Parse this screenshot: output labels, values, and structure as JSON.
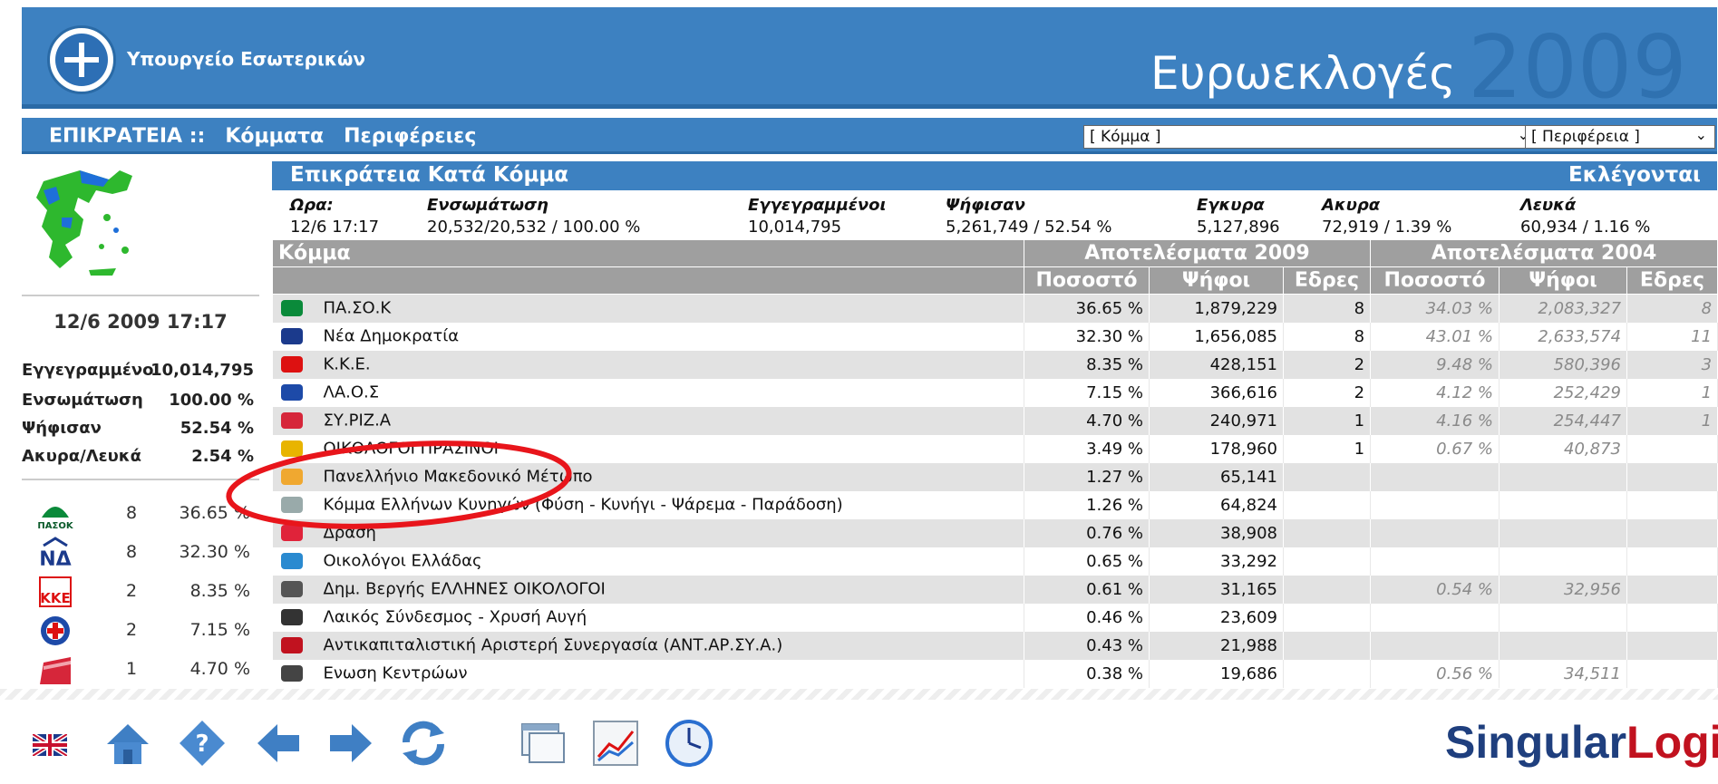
{
  "header": {
    "ministry": "Υπουργείο Εσωτερικών",
    "title": "Ευρωεκλογές",
    "year": "2009"
  },
  "nav": {
    "scope": "ΕΠΙΚΡΑΤΕΙΑ ::",
    "link_parties": "Κόμματα",
    "link_regions": "Περιφέρειες",
    "party_select": "[ Κόμμα ]",
    "region_select": "[ Περιφέρεια ]"
  },
  "left": {
    "datetime": "12/6 2009 17:17",
    "stats": [
      {
        "label": "Εγγεγραμμένοι",
        "value": "10,014,795"
      },
      {
        "label": "Ενσωμάτωση",
        "value": "100.00 %"
      },
      {
        "label": "Ψήφισαν",
        "value": "52.54 %"
      },
      {
        "label": "Ακυρα/Λευκά",
        "value": "2.54 %"
      }
    ],
    "parties": [
      {
        "logo": "ΠΑΣΟΚ",
        "seats": "8",
        "pct": "36.65 %"
      },
      {
        "logo": "ΝΔ",
        "seats": "8",
        "pct": "32.30 %"
      },
      {
        "logo": "ΚΚΕ",
        "seats": "2",
        "pct": "8.35 %"
      },
      {
        "logo": "ΛΑΟΣ",
        "seats": "2",
        "pct": "7.15 %"
      },
      {
        "logo": "ΣΥΡΙΖΑ",
        "seats": "1",
        "pct": "4.70 %"
      }
    ]
  },
  "main": {
    "title": "Επικράτεια Κατά Κόμμα",
    "right_title": "Εκλέγονται",
    "summary": {
      "labels": [
        "Ωρα:",
        "Ενσωμάτωση",
        "Εγγεγραμμένοι",
        "Ψήφισαν",
        "Εγκυρα",
        "Ακυρα",
        "Λευκά"
      ],
      "values": [
        "12/6 17:17",
        "20,532/20,532 / 100.00 %",
        "10,014,795",
        "5,261,749 / 52.54 %",
        "5,127,896",
        "72,919 / 1.39 %",
        "60,934 / 1.16 %"
      ]
    },
    "col_party": "Κόμμα",
    "group_2009": "Αποτελέσματα 2009",
    "group_2004": "Αποτελέσματα 2004",
    "sub": {
      "pct": "Ποσοστό",
      "votes": "Ψήφοι",
      "seats": "Εδρες"
    },
    "rows": [
      {
        "logo": "ΠΑΣΟΚ",
        "name": "ΠΑ.ΣΟ.Κ",
        "pct": "36.65 %",
        "votes": "1,879,229",
        "seats": "8",
        "pct04": "34.03 %",
        "votes04": "2,083,327",
        "seats04": "8"
      },
      {
        "logo": "ΝΔ",
        "name": "Νέα Δημοκρατία",
        "pct": "32.30 %",
        "votes": "1,656,085",
        "seats": "8",
        "pct04": "43.01 %",
        "votes04": "2,633,574",
        "seats04": "11"
      },
      {
        "logo": "ΚΚΕ",
        "name": "Κ.Κ.Ε.",
        "pct": "8.35 %",
        "votes": "428,151",
        "seats": "2",
        "pct04": "9.48 %",
        "votes04": "580,396",
        "seats04": "3"
      },
      {
        "logo": "ΛΑΟΣ",
        "name": "ΛΑ.Ο.Σ",
        "pct": "7.15 %",
        "votes": "366,616",
        "seats": "2",
        "pct04": "4.12 %",
        "votes04": "252,429",
        "seats04": "1"
      },
      {
        "logo": "ΣΥΡΙΖΑ",
        "name": "ΣΥ.ΡΙΖ.Α",
        "pct": "4.70 %",
        "votes": "240,971",
        "seats": "1",
        "pct04": "4.16 %",
        "votes04": "254,447",
        "seats04": "1"
      },
      {
        "logo": "ΟΠ",
        "name": "ΟΙΚΟΛΟΓΟΙ ΠΡΑΣΙΝΟΙ",
        "pct": "3.49 %",
        "votes": "178,960",
        "seats": "1",
        "pct04": "0.67 %",
        "votes04": "40,873",
        "seats04": ""
      },
      {
        "logo": "ΠΜΜ",
        "name": "Πανελλήνιο Μακεδονικό Μέτωπο",
        "pct": "1.27 %",
        "votes": "65,141",
        "seats": "",
        "pct04": "",
        "votes04": "",
        "seats04": ""
      },
      {
        "logo": "ΚΕΚ",
        "name": "Κόμμα Ελλήνων Κυνηγών (Φύση - Κυνήγι - Ψάρεμα - Παράδοση)",
        "pct": "1.26 %",
        "votes": "64,824",
        "seats": "",
        "pct04": "",
        "votes04": "",
        "seats04": ""
      },
      {
        "logo": "Δράση",
        "name": "Δράση",
        "pct": "0.76 %",
        "votes": "38,908",
        "seats": "",
        "pct04": "",
        "votes04": "",
        "seats04": ""
      },
      {
        "logo": "ΟΕ",
        "name": "Οικολόγοι Ελλάδας",
        "pct": "0.65 %",
        "votes": "33,292",
        "seats": "",
        "pct04": "",
        "votes04": "",
        "seats04": ""
      },
      {
        "logo": "ΔΒ",
        "name": "Δημ. Βεργής ΕΛΛΗΝΕΣ ΟΙΚΟΛΟΓΟΙ",
        "pct": "0.61 %",
        "votes": "31,165",
        "seats": "",
        "pct04": "0.54 %",
        "votes04": "32,956",
        "seats04": ""
      },
      {
        "logo": "ΧΑ",
        "name": "Λαικός Σύνδεσμος - Χρυσή Αυγή",
        "pct": "0.46 %",
        "votes": "23,609",
        "seats": "",
        "pct04": "",
        "votes04": "",
        "seats04": ""
      },
      {
        "logo": "ΑΝΤΑΡΣΥΑ",
        "name": "Αντικαπιταλιστική Αριστερή Συνεργασία (ΑΝΤ.ΑΡ.ΣΥ.Α.)",
        "pct": "0.43 %",
        "votes": "21,988",
        "seats": "",
        "pct04": "",
        "votes04": "",
        "seats04": ""
      },
      {
        "logo": "ΕΚ",
        "name": "Ενωση Κεντρώων",
        "pct": "0.38 %",
        "votes": "19,686",
        "seats": "",
        "pct04": "0.56 %",
        "votes04": "34,511",
        "seats04": ""
      }
    ]
  },
  "footer": {
    "brand_a": "Singular",
    "brand_b": "Logic",
    "tools": [
      "uk-flag-icon",
      "home-icon",
      "help-icon",
      "back-arrow-icon",
      "forward-arrow-icon",
      "refresh-icon",
      "window-icon",
      "chart-icon",
      "clock-icon"
    ]
  },
  "colors": {
    "header_blue": "#3d81c1",
    "table_grey": "#9f9f9f",
    "highlight_red": "#e8151b"
  }
}
